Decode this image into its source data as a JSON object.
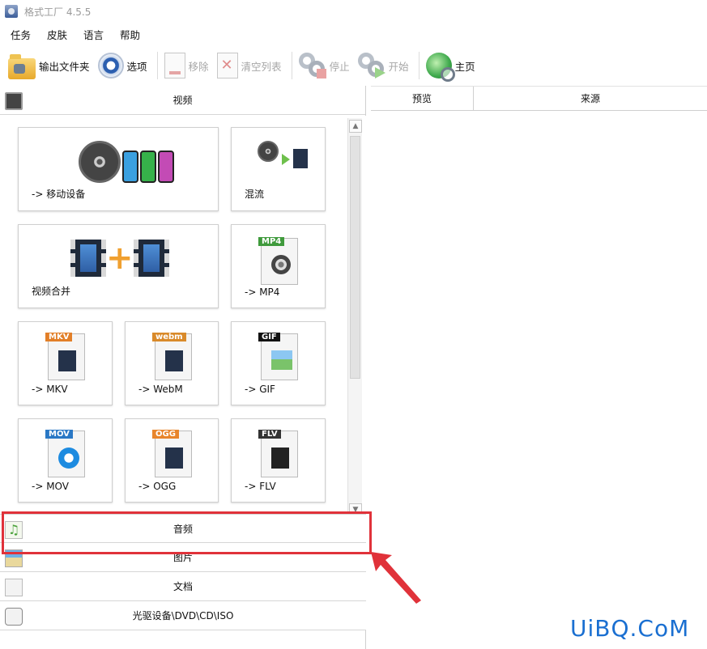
{
  "window": {
    "title": "格式工厂 4.5.5"
  },
  "menu": [
    {
      "name": "menu-task",
      "label": "任务"
    },
    {
      "name": "menu-skin",
      "label": "皮肤"
    },
    {
      "name": "menu-language",
      "label": "语言"
    },
    {
      "name": "menu-help",
      "label": "帮助"
    }
  ],
  "toolbar": {
    "output_folder": "输出文件夹",
    "options": "选项",
    "remove": "移除",
    "clear_list": "清空列表",
    "stop": "停止",
    "start": "开始",
    "home": "主页"
  },
  "categories": {
    "video": "视频",
    "audio": "音频",
    "picture": "图片",
    "document": "文档",
    "disc": "光驱设备\\DVD\\CD\\ISO"
  },
  "video_tiles": {
    "mobile": "-> 移动设备",
    "mux": "混流",
    "merge": "视频合并",
    "mp4": "-> MP4",
    "mkv": "-> MKV",
    "webm": "-> WebM",
    "gif": "-> GIF",
    "mov": "-> MOV",
    "ogg": "-> OGG",
    "flv": "-> FLV"
  },
  "file_tags": {
    "mp4": "MP4",
    "mkv": "MKV",
    "webm": "webm",
    "gif": "GIF",
    "mov": "MOV",
    "ogg": "OGG",
    "flv": "FLV"
  },
  "task_list": {
    "columns": [
      "预览",
      "来源"
    ]
  },
  "watermark": "UiBQ.CoM",
  "colors": {
    "highlight": "#e0323a",
    "watermark": "#1a6fd1"
  }
}
